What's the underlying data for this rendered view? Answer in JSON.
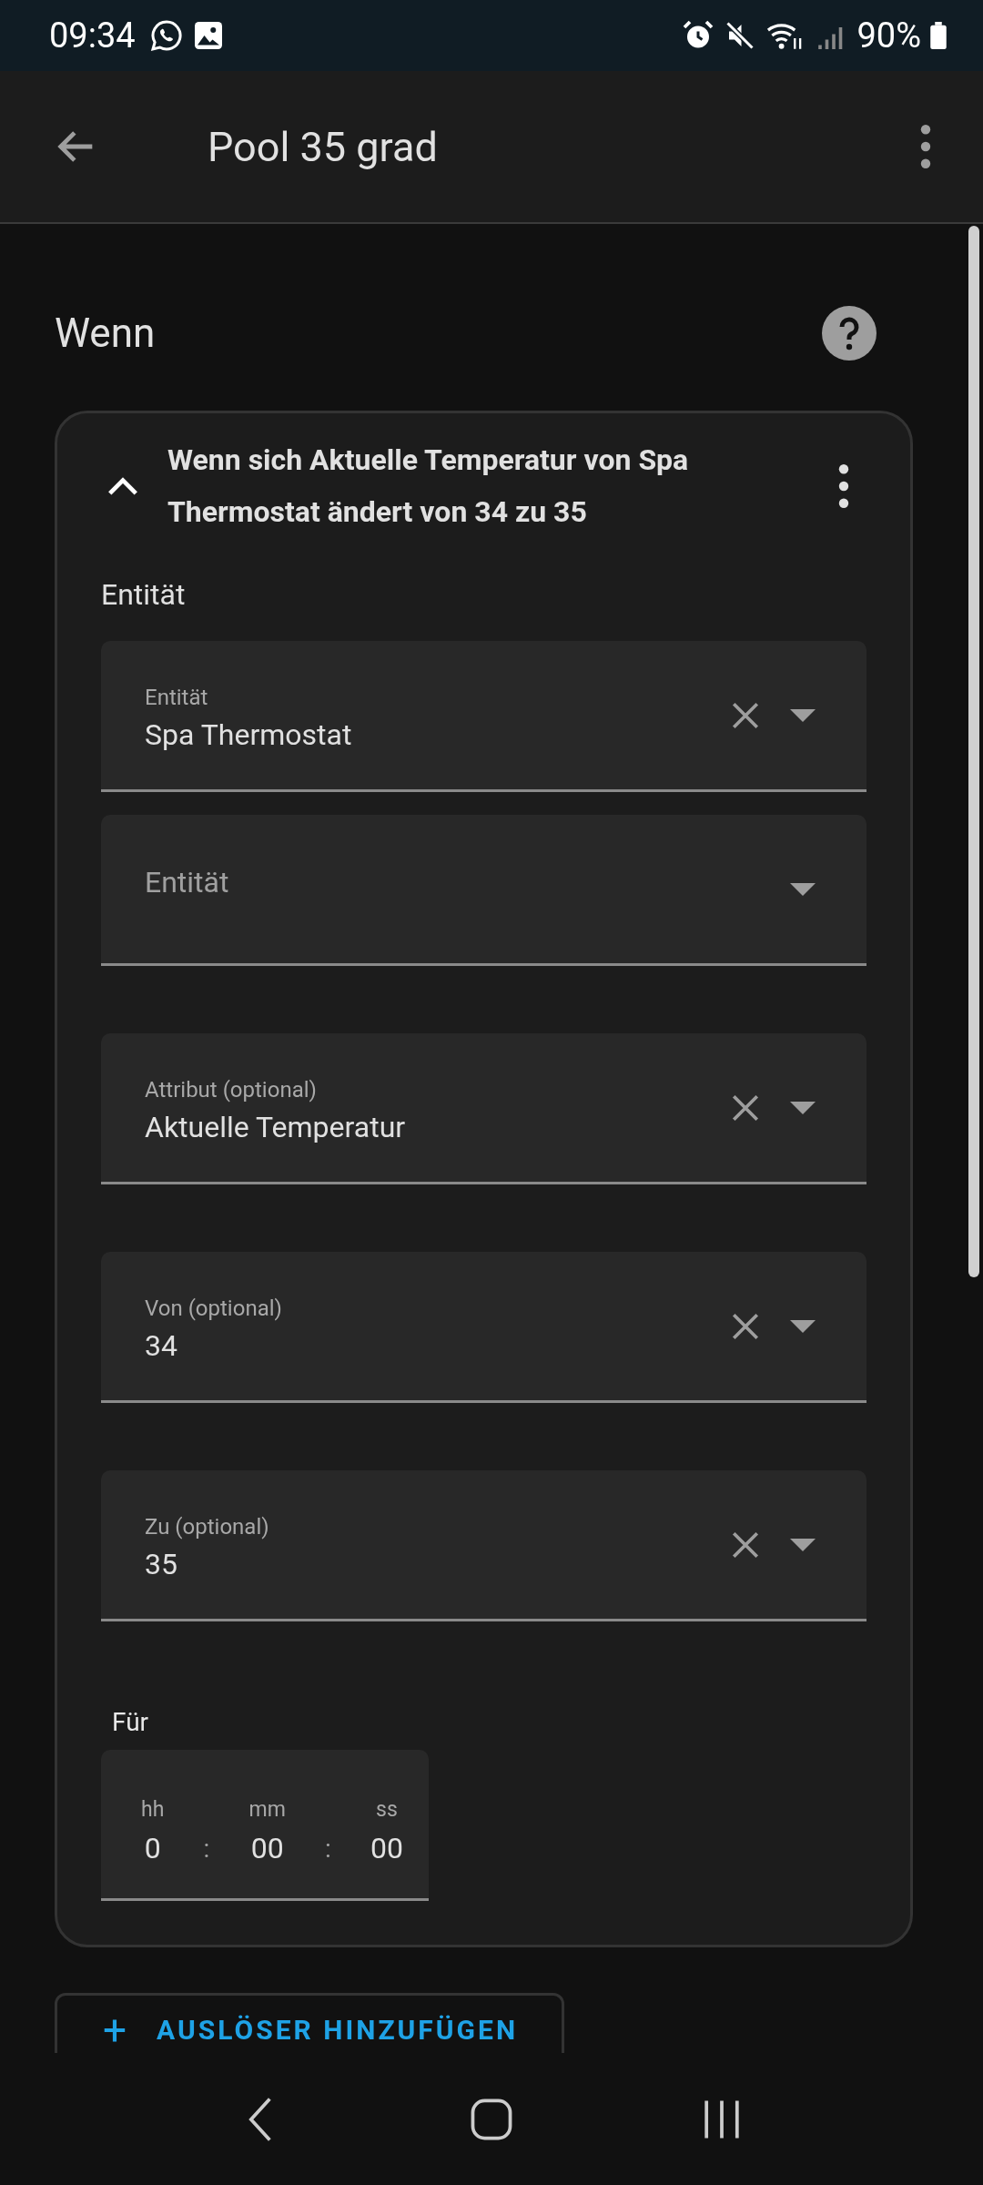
{
  "status_bar": {
    "time": "09:34",
    "battery": "90%"
  },
  "app_bar": {
    "title": "Pool 35 grad"
  },
  "section": {
    "title": "Wenn"
  },
  "trigger": {
    "expanded": true,
    "summary": "Wenn sich Aktuelle Temperatur von Spa Thermostat ändert von 34 zu 35",
    "entity_group": {
      "label": "Entität",
      "fields": [
        {
          "label": "Entität",
          "value": "Spa Thermostat",
          "clearable": true
        },
        {
          "placeholder": "Entität",
          "clearable": false
        }
      ]
    },
    "fields": [
      {
        "label": "Attribut (optional)",
        "value": "Aktuelle Temperatur",
        "clearable": true
      },
      {
        "label": "Von (optional)",
        "value": "34",
        "clearable": true
      },
      {
        "label": "Zu (optional)",
        "value": "35",
        "clearable": true
      }
    ],
    "duration": {
      "label": "Für",
      "parts": [
        {
          "unit": "hh",
          "value": "0"
        },
        {
          "unit": "mm",
          "value": "00"
        },
        {
          "unit": "ss",
          "value": "00"
        }
      ],
      "separator": ":"
    }
  },
  "add_button": {
    "icon": "+",
    "label": "AUSLÖSER HINZUFÜGEN"
  }
}
